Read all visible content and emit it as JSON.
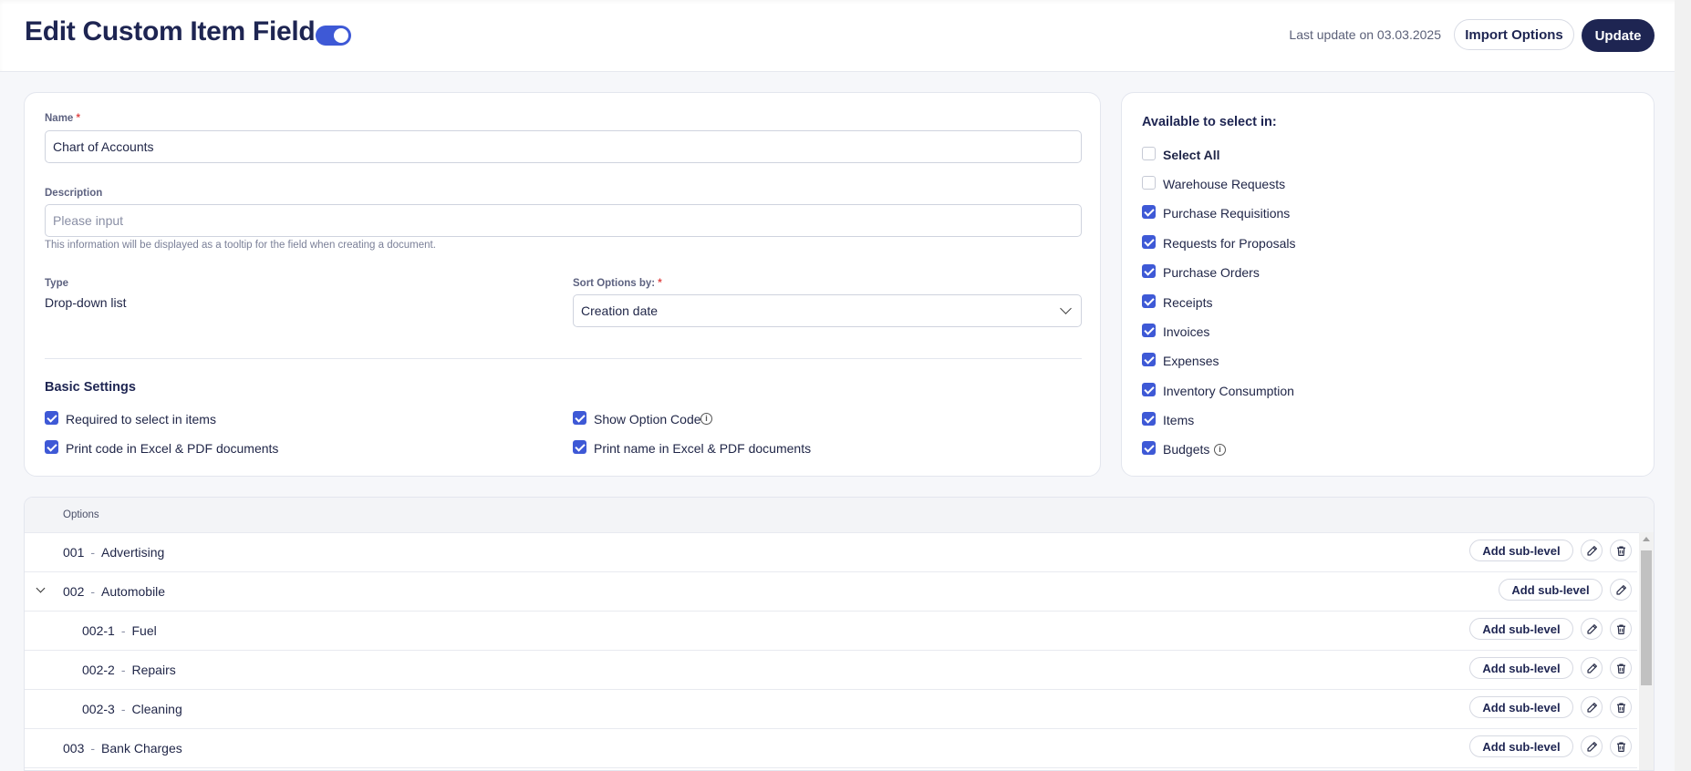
{
  "header": {
    "title": "Edit Custom Item Field",
    "active": true,
    "last_update": "Last update on 03.03.2025",
    "import_label": "Import Options",
    "update_label": "Update"
  },
  "form": {
    "name_label": "Name",
    "required_mark": "*",
    "name_value": "Chart of Accounts",
    "description_label": "Description",
    "description_placeholder": "Please input",
    "description_hint": "This information will be displayed as a tooltip for the field when creating a document.",
    "type_label": "Type",
    "type_value": "Drop-down list",
    "sort_label": "Sort Options by:",
    "sort_value": "Creation date",
    "basic_settings_title": "Basic Settings",
    "settings": [
      {
        "label": "Required to select in items",
        "checked": true
      },
      {
        "label": "Show Option Code",
        "checked": true,
        "info": true
      },
      {
        "label": "Print code in Excel & PDF documents",
        "checked": true
      },
      {
        "label": "Print name in Excel & PDF documents",
        "checked": true
      }
    ]
  },
  "available": {
    "title": "Available to select in:",
    "items": [
      {
        "label": "Select All",
        "checked": false,
        "bold": true
      },
      {
        "label": "Warehouse Requests",
        "checked": false
      },
      {
        "label": "Purchase Requisitions",
        "checked": true
      },
      {
        "label": "Requests for Proposals",
        "checked": true
      },
      {
        "label": "Purchase Orders",
        "checked": true
      },
      {
        "label": "Receipts",
        "checked": true
      },
      {
        "label": "Invoices",
        "checked": true
      },
      {
        "label": "Expenses",
        "checked": true
      },
      {
        "label": "Inventory Consumption",
        "checked": true
      },
      {
        "label": "Items",
        "checked": true
      },
      {
        "label": "Budgets",
        "checked": true,
        "info": true
      }
    ]
  },
  "options": {
    "header": "Options",
    "add_sub_label": "Add sub-level",
    "rows": [
      {
        "code": "001",
        "name": "Advertising",
        "level": 0,
        "delete": true
      },
      {
        "code": "002",
        "name": "Automobile",
        "level": 0,
        "expanded": true,
        "delete": false
      },
      {
        "code": "002-1",
        "name": "Fuel",
        "level": 1,
        "delete": true
      },
      {
        "code": "002-2",
        "name": "Repairs",
        "level": 1,
        "delete": true
      },
      {
        "code": "002-3",
        "name": "Cleaning",
        "level": 1,
        "delete": true
      },
      {
        "code": "003",
        "name": "Bank Charges",
        "level": 0,
        "delete": true
      }
    ]
  },
  "colors": {
    "accent": "#3e59d6",
    "primary": "#1e2552",
    "required": "#e04848"
  }
}
